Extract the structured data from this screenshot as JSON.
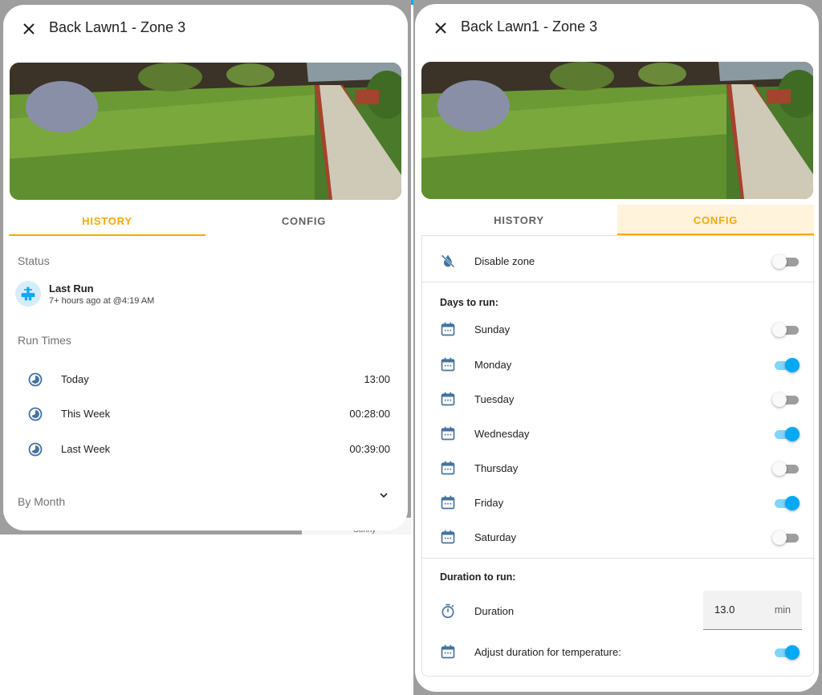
{
  "left_dialog": {
    "title": "Back Lawn1 - Zone 3",
    "tabs": [
      {
        "label": "HISTORY"
      },
      {
        "label": "CONFIG"
      }
    ],
    "status_label": "Status",
    "last_run": {
      "title": "Last Run",
      "subtitle": "7+ hours ago at @4:19 AM"
    },
    "run_times_label": "Run Times",
    "run_times": [
      {
        "label": "Today",
        "value": "13:00"
      },
      {
        "label": "This Week",
        "value": "00:28:00"
      },
      {
        "label": "Last Week",
        "value": "00:39:00"
      }
    ],
    "by_month_label": "By Month"
  },
  "right_dialog": {
    "title": "Back Lawn1 - Zone 3",
    "tabs": [
      {
        "label": "HISTORY"
      },
      {
        "label": "CONFIG"
      }
    ],
    "disable_zone": {
      "label": "Disable zone",
      "on": false
    },
    "days_heading": "Days to run:",
    "days": [
      {
        "label": "Sunday",
        "on": false
      },
      {
        "label": "Monday",
        "on": true
      },
      {
        "label": "Tuesday",
        "on": false
      },
      {
        "label": "Wednesday",
        "on": true
      },
      {
        "label": "Thursday",
        "on": false
      },
      {
        "label": "Friday",
        "on": true
      },
      {
        "label": "Saturday",
        "on": false
      }
    ],
    "duration_heading": "Duration to run:",
    "duration": {
      "label": "Duration",
      "value": "13.0",
      "unit": "min"
    },
    "adjust": {
      "label": "Adjust duration for temperature:",
      "on": true
    }
  },
  "background": {
    "sunny_text": "Sunny"
  },
  "colors": {
    "accent": "#ffa600",
    "toggle_on": "#03a9f4",
    "icon": "#44739e",
    "header_bar": "#03a9f4"
  },
  "icons": {
    "close": "close-icon",
    "valve": "water-valve-icon",
    "clock": "clock-icon",
    "calendar": "calendar-icon",
    "disable": "water-off-icon",
    "timer": "timer-icon",
    "chevron": "chevron-down-icon"
  }
}
